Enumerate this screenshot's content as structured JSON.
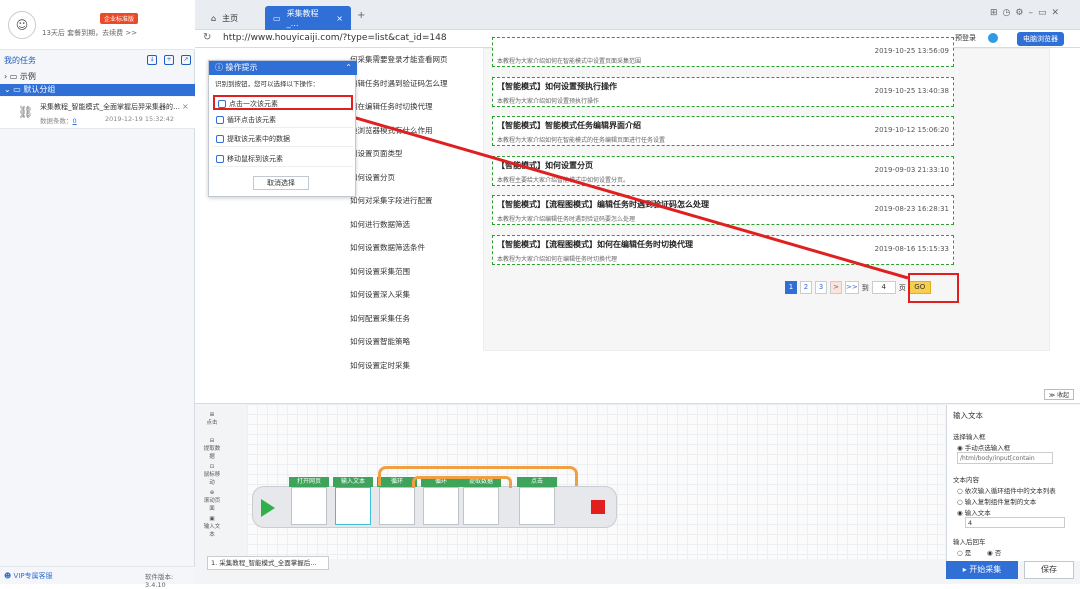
{
  "sidebar": {
    "badge": "企业标准版",
    "expiry": "13天后 套餐到期，去续费 >>",
    "my_tasks": "我的任务",
    "tree_example": "示例",
    "tree_default": "默认分组",
    "task_name": "采集教程_智能模式_全面掌握后羿采集器的…",
    "task_count_label": "数据条数：",
    "task_count": "0",
    "task_date": "2019-12-19 15:32:42",
    "vip": "VIP专属客服",
    "version": "软件版本: 3.4.10"
  },
  "browser": {
    "tab_home": "主页",
    "tab_active": "采集教程_…",
    "url": "http://www.houyicaiji.com/?type=list&cat_id=148",
    "login": "预登录",
    "browser_btn": "电脑浏览器"
  },
  "leftnav": {
    "items": [
      "何采集需要登录才能查看网页",
      "编辑任务时遇到验证码怎么理",
      "何在编辑任务时切换代理",
      "换浏览器模式有什么作用",
      "何设置页面类型",
      "如何设置分页",
      "如何对采集字段进行配置",
      "如何进行数据筛选",
      "如何设置数据筛选条件",
      "如何设置采集范围",
      "如何设置深入采集",
      "如何配置采集任务",
      "如何设置智能策略",
      "如何设置定时采集"
    ]
  },
  "articles": [
    {
      "title": "",
      "desc": "本教程为大家介绍如何在智能模式中设置页面采集范围",
      "date": "2019-10-25 13:56:09"
    },
    {
      "title": "【智能模式】如何设置预执行操作",
      "desc": "本教程为大家介绍如何设置预执行操作",
      "date": "2019-10-25 13:40:38"
    },
    {
      "title": "【智能模式】智能模式任务编辑界面介绍",
      "desc": "本教程为大家介绍如何在智能模式的任务编辑页面进行任务设置",
      "date": "2019-10-12 15:06:20"
    },
    {
      "title": "【智能模式】如何设置分页",
      "desc": "本教程主要给大家介绍智能模式中如何设置分页。",
      "date": "2019-09-03 21:33:10"
    },
    {
      "title": "【智能模式】【流程图模式】编辑任务时遇到验证码怎么处理",
      "desc": "本教程为大家介绍编辑任务时遇到验证码要怎么处理",
      "date": "2019-08-23 16:28:31"
    },
    {
      "title": "【智能模式】【流程图模式】如何在编辑任务时切换代理",
      "desc": "本教程为大家介绍如何在编辑任务时切换代理",
      "date": "2019-08-16 15:15:33"
    }
  ],
  "pager": {
    "p1": "1",
    "p2": "2",
    "p3": "3",
    "next": ">",
    "last": ">>",
    "to": "到",
    "page_input": "4",
    "page": "页",
    "go": "GO"
  },
  "popup": {
    "title": "操作提示",
    "desc": "识别到按钮，您可以选择以下操作：",
    "items": [
      "点击一次该元素",
      "循环点击该元素",
      "提取该元素中的数据",
      "移动鼠标到该元素"
    ],
    "cancel": "取消选择"
  },
  "tools": [
    "点击",
    "提取数据",
    "鼠标移动",
    "滚动页面",
    "输入文本"
  ],
  "flow": {
    "steps": [
      "打开网页",
      "输入文本",
      "循环",
      "循环",
      "提取数据",
      "点击"
    ]
  },
  "collapse": "收起",
  "props": {
    "title": "输入文本",
    "select_input": "选择输入框",
    "opt_manual": "手动点选输入框",
    "xpath": "/html/body/input[contain",
    "text_content": "文本内容",
    "opt_loop": "依次输入循环组件中的文本列表",
    "opt_copy": "输入复制组件复制的文本",
    "opt_input": "输入文本",
    "input_value": "4",
    "enter_after": "输入后回车",
    "yes": "是",
    "no": "否"
  },
  "task_tab": "1. 采集教程_智能模式_全面掌握后…",
  "start": "开始采集",
  "save": "保存"
}
